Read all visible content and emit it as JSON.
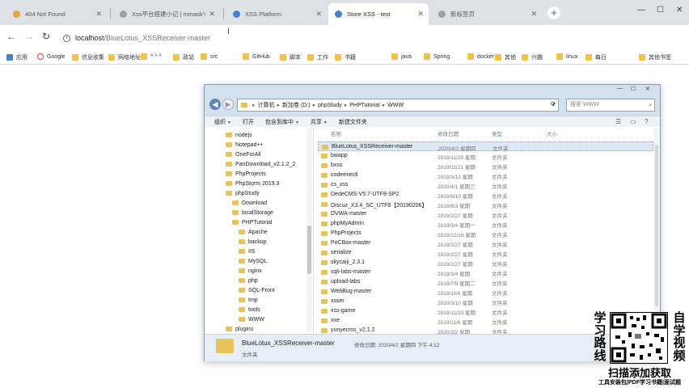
{
  "browser": {
    "tabs": [
      {
        "title": "404 Not Found",
        "color": "#e8a33c",
        "active": false
      },
      {
        "title": "Xss平台搭建小记 | mmask's 基...",
        "color": "#9aa0a6",
        "active": false
      },
      {
        "title": "XSS Platform",
        "color": "#4a7fd0",
        "active": false
      },
      {
        "title": "Store XSS - test",
        "color": "#4a7fd0",
        "active": true
      },
      {
        "title": "新标签页",
        "color": "#9aa0a6",
        "active": false
      }
    ],
    "new_tab_label": "+",
    "address": {
      "host": "localhost",
      "path": "/BlueLotus_XSSReceiver-master"
    },
    "bookmarks": [
      {
        "label": "应用",
        "kind": "grid"
      },
      {
        "label": "Google",
        "kind": "g"
      },
      {
        "label": "信息收集",
        "kind": "folder"
      },
      {
        "label": "网络地址",
        "kind": "folder"
      },
      {
        "label": "^ ^ ^",
        "kind": "folder"
      },
      {
        "label": "政站",
        "kind": "folder"
      },
      {
        "label": "src",
        "kind": "folder"
      },
      {
        "label": "GitHub",
        "kind": "folder"
      },
      {
        "label": "脚本",
        "kind": "folder"
      },
      {
        "label": "工作",
        "kind": "folder"
      },
      {
        "label": "书籍",
        "kind": "folder"
      },
      {
        "label": "java",
        "kind": "folder"
      },
      {
        "label": "Spring",
        "kind": "folder"
      },
      {
        "label": "docker",
        "kind": "folder"
      },
      {
        "label": "其他",
        "kind": "folder"
      },
      {
        "label": "兴趣",
        "kind": "folder"
      },
      {
        "label": "linux",
        "kind": "folder"
      },
      {
        "label": "每日",
        "kind": "folder"
      },
      {
        "label": "其他书签",
        "kind": "folder"
      }
    ]
  },
  "explorer": {
    "breadcrumb": [
      "计算机",
      "新加卷 (D:)",
      "phpStudy",
      "PHPTutorial",
      "WWW"
    ],
    "search_placeholder": "搜索 WWW",
    "commands": [
      "组织",
      "打开",
      "包含到库中",
      "共享",
      "新建文件夹"
    ],
    "columns": {
      "name": "名称",
      "date": "修改日期",
      "type": "类型",
      "size": "大小"
    },
    "nav_items": [
      {
        "label": "nodejs",
        "level": 0
      },
      {
        "label": "Notepad++",
        "level": 0
      },
      {
        "label": "OneForAll",
        "level": 0
      },
      {
        "label": "PanDownload_v2.1.2_2",
        "level": 0
      },
      {
        "label": "PhpProjects",
        "level": 0
      },
      {
        "label": "PhpStorm 2019.3",
        "level": 0
      },
      {
        "label": "phpStudy",
        "level": 0
      },
      {
        "label": "Download",
        "level": 1
      },
      {
        "label": "localStorage",
        "level": 1
      },
      {
        "label": "PHPTutorial",
        "level": 1
      },
      {
        "label": "Apache",
        "level": 2
      },
      {
        "label": "backup",
        "level": 2
      },
      {
        "label": "IIS",
        "level": 2
      },
      {
        "label": "MySQL",
        "level": 2
      },
      {
        "label": "nginx",
        "level": 2
      },
      {
        "label": "php",
        "level": 2
      },
      {
        "label": "SQL-Front",
        "level": 2
      },
      {
        "label": "tmp",
        "level": 2
      },
      {
        "label": "tools",
        "level": 2
      },
      {
        "label": "WWW",
        "level": 2
      },
      {
        "label": "plugins",
        "level": 0
      }
    ],
    "files": [
      {
        "name": "BlueLotus_XSSReceiver-master",
        "date": "2020/4/2 星期四",
        "type": "文件夹",
        "selected": true
      },
      {
        "name": "bwapp",
        "date": "2019/11/29 星期",
        "type": "文件夹"
      },
      {
        "name": "bxss",
        "date": "2019/11/21 星期",
        "type": "文件夹"
      },
      {
        "name": "codeexectl",
        "date": "2019/3/12 星期",
        "type": "文件夹"
      },
      {
        "name": "cs_xss",
        "date": "2020/4/1 星期三",
        "type": "文件夹"
      },
      {
        "name": "DedeCMS-V5.7-UTF8-SP2",
        "date": "2019/9/10 星期",
        "type": "文件夹"
      },
      {
        "name": "Discuz_X3.4_SC_UTF8【20190206】",
        "date": "2019/9/3 星期",
        "type": "文件夹"
      },
      {
        "name": "DVWA-master",
        "date": "2019/2/27 星期",
        "type": "文件夹"
      },
      {
        "name": "phpMyAdmin",
        "date": "2019/3/4 星期一",
        "type": "文件夹"
      },
      {
        "name": "PhpProjects",
        "date": "2019/12/18 星期",
        "type": "文件夹"
      },
      {
        "name": "PoCBox-master",
        "date": "2019/2/27 星期",
        "type": "文件夹"
      },
      {
        "name": "serialize",
        "date": "2019/2/27 星期",
        "type": "文件夹"
      },
      {
        "name": "skycaiji_2.3.1",
        "date": "2019/2/27 星期",
        "type": "文件夹"
      },
      {
        "name": "sqli-labs-master",
        "date": "2019/3/4 星期",
        "type": "文件夹"
      },
      {
        "name": "upload-labs",
        "date": "2019/7/9 星期二",
        "type": "文件夹"
      },
      {
        "name": "WebBug-master",
        "date": "2019/11/6 星期",
        "type": "文件夹"
      },
      {
        "name": "xsser",
        "date": "2020/3/10 星期",
        "type": "文件夹"
      },
      {
        "name": "xss-game",
        "date": "2019/11/20 星期",
        "type": "文件夹"
      },
      {
        "name": "xxe",
        "date": "2019/11/6 星期",
        "type": "文件夹"
      },
      {
        "name": "yunyecms_v2.1.2",
        "date": "2020/3/2 星期",
        "type": "文件夹"
      }
    ],
    "details": {
      "name": "BlueLotus_XSSReceiver-master",
      "date": "修改日期: 2020/4/2 星期四 下午 4:12",
      "type": "文件夹"
    }
  },
  "promo": {
    "left_chars": [
      "学",
      "习",
      "路",
      "线"
    ],
    "right_chars": [
      "自",
      "学",
      "视",
      "频"
    ],
    "headline": "扫描添加获取",
    "subline": "工具安装包|PDF学习书籍|面试题"
  },
  "colors": {
    "folder": "#e8c35a",
    "selection": "#dde8f5",
    "chrome_bg": "#dee1e6"
  }
}
